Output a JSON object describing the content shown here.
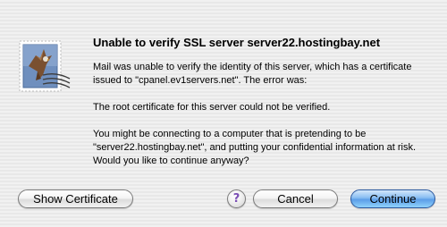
{
  "dialog": {
    "icon": "mail-stamp-eagle-icon",
    "title": "Unable to verify SSL server server22.hostingbay.net",
    "paragraphs": [
      "Mail was unable to verify the identity of this server, which has a certificate issued to \"cpanel.ev1servers.net\". The error was:",
      "The root certificate for this server could not be verified.",
      "You might be connecting to a computer that is pretending to be \"server22.hostingbay.net\", and putting your confidential information at risk. Would you like to continue anyway?"
    ]
  },
  "buttons": {
    "show_certificate": "Show Certificate",
    "help_icon": "?",
    "cancel": "Cancel",
    "continue": "Continue"
  },
  "colors": {
    "background": "#ececec",
    "default_button": "#5c9ee8",
    "help_glyph": "#7b4fb5"
  }
}
